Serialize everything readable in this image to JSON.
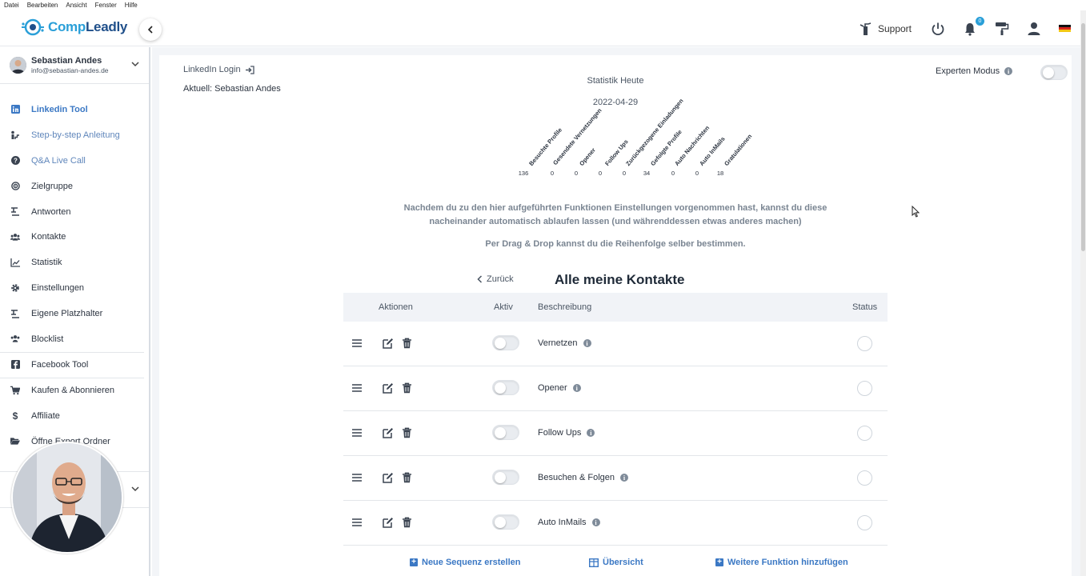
{
  "os_menu": [
    "Datei",
    "Bearbeiten",
    "Ansicht",
    "Fenster",
    "Hilfe"
  ],
  "header": {
    "logo_part1": "Comp",
    "logo_part2": "Leadly",
    "support_label": "Support",
    "notification_count": "0"
  },
  "sidebar": {
    "user_name": "Sebastian Andes",
    "user_email": "info@sebastian-andes.de",
    "items": [
      {
        "label": "Linkedin Tool",
        "icon": "linkedin-icon"
      },
      {
        "label": "Step-by-step Anleitung",
        "icon": "steps-icon"
      },
      {
        "label": "Q&A Live Call",
        "icon": "question-icon"
      },
      {
        "label": "Zielgruppe",
        "icon": "target-icon"
      },
      {
        "label": "Antworten",
        "icon": "reply-icon"
      },
      {
        "label": "Kontakte",
        "icon": "users-icon"
      },
      {
        "label": "Statistik",
        "icon": "chart-icon"
      },
      {
        "label": "Einstellungen",
        "icon": "gear-icon"
      },
      {
        "label": "Eigene Platzhalter",
        "icon": "placeholder-icon"
      },
      {
        "label": "Blocklist",
        "icon": "block-users-icon"
      },
      {
        "label": "Facebook Tool",
        "icon": "facebook-icon"
      },
      {
        "label": "Kaufen & Abonnieren",
        "icon": "cart-icon"
      },
      {
        "label": "Affiliate",
        "icon": "dollar-icon"
      },
      {
        "label": "Öffne Export Ordner",
        "icon": "folder-icon"
      }
    ]
  },
  "main": {
    "linkedin_login": "LinkedIn Login",
    "aktuell": "Aktuell: Sebastian Andes",
    "stat_title": "Statistik Heute",
    "stat_date": "2022-04-29",
    "expert_mode": "Experten Modus",
    "stats": [
      {
        "label": "Besuchte Profile",
        "value": "136"
      },
      {
        "label": "Gesendete Vernetzungen",
        "value": "0"
      },
      {
        "label": "Opener",
        "value": "0"
      },
      {
        "label": "Follow Ups",
        "value": "0"
      },
      {
        "label": "Zurückgezogene Einladungen",
        "value": "0"
      },
      {
        "label": "Gefolgte Profile",
        "value": "34"
      },
      {
        "label": "Auto Nachrichten",
        "value": "0"
      },
      {
        "label": "Auto InMails",
        "value": "0"
      },
      {
        "label": "Gratulationen",
        "value": "18"
      }
    ],
    "info_line1": "Nachdem du zu den hier aufgeführten Funktionen Einstellungen vorgenommen hast, kannst du diese",
    "info_line2": "nacheinander automatisch ablaufen lassen (und währenddessen etwas anderes machen)",
    "info_line3": "Per Drag & Drop kannst du die Reihenfolge selber bestimmen.",
    "back_label": "Zurück",
    "table_title": "Alle meine Kontakte",
    "columns": {
      "actions": "Aktionen",
      "active": "Aktiv",
      "description": "Beschreibung",
      "status": "Status"
    },
    "rows": [
      {
        "description": "Vernetzen",
        "active": false
      },
      {
        "description": "Opener",
        "active": false
      },
      {
        "description": "Follow Ups",
        "active": false
      },
      {
        "description": "Besuchen & Folgen",
        "active": false
      },
      {
        "description": "Auto InMails",
        "active": false
      }
    ],
    "footer": {
      "new_sequence": "Neue Sequenz erstellen",
      "overview": "Übersicht",
      "add_function": "Weitere Funktion hinzufügen"
    }
  },
  "colors": {
    "accent": "#3b78c4",
    "logo_blue": "#2a9fd8"
  }
}
